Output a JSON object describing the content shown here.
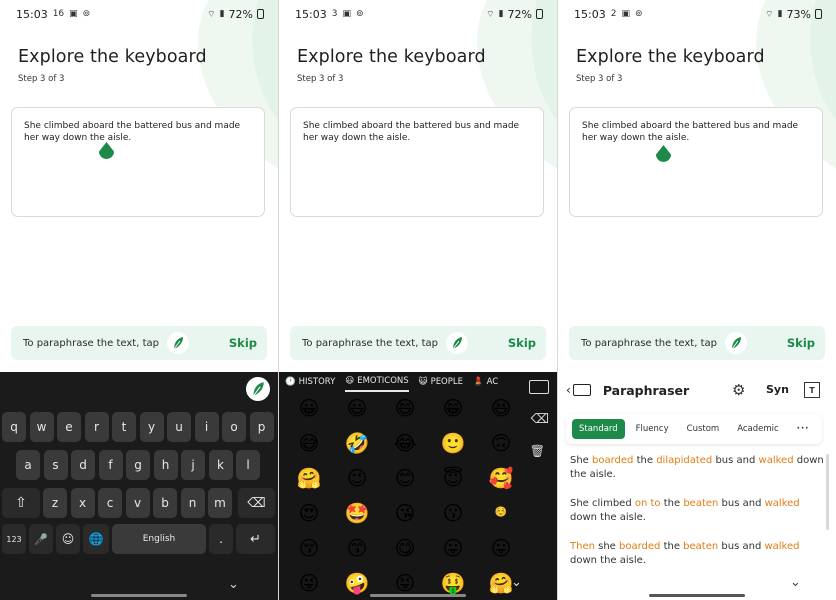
{
  "panels": [
    {
      "status": {
        "time": "15:03",
        "mini": "16",
        "battery": "72%"
      },
      "title": "Explore the keyboard",
      "step": "Step 3 of 3",
      "text": "She climbed aboard the battered bus and made her way down the aisle.",
      "hint": {
        "text": "To paraphrase the text, tap",
        "skip": "Skip"
      }
    },
    {
      "status": {
        "time": "15:03",
        "mini": "3",
        "battery": "72%"
      },
      "title": "Explore the keyboard",
      "step": "Step 3 of 3",
      "text": "She climbed aboard the battered bus and made her way down the aisle.",
      "hint": {
        "text": "To paraphrase the text, tap",
        "skip": "Skip"
      }
    },
    {
      "status": {
        "time": "15:03",
        "mini": "2",
        "battery": "73%"
      },
      "title": "Explore the keyboard",
      "step": "Step 3 of 3",
      "text": "She climbed aboard the battered bus and made her way down the aisle.",
      "hint": {
        "text": "To paraphrase the text, tap",
        "skip": "Skip"
      }
    }
  ],
  "keyboard": {
    "row1": [
      "q",
      "w",
      "e",
      "r",
      "t",
      "y",
      "u",
      "i",
      "o",
      "p"
    ],
    "row2": [
      "a",
      "s",
      "d",
      "f",
      "g",
      "h",
      "j",
      "k",
      "l"
    ],
    "row3": [
      "z",
      "x",
      "c",
      "v",
      "b",
      "n",
      "m"
    ],
    "shift": "⇧",
    "backspace": "⌫",
    "num": "123",
    "mic": "🎤",
    "emoji": "☺",
    "globe": "🌐",
    "space": "English",
    "period": ".",
    "enter": "↵"
  },
  "emoji_panel": {
    "tabs": [
      "HISTORY",
      "EMOTICONS",
      "PEOPLE",
      "AC"
    ],
    "tab_icons": [
      "🕐",
      "😃",
      "😺",
      "💄"
    ],
    "emojis": [
      "😀",
      "😃",
      "😄",
      "😁",
      "😆",
      "😅",
      "🤣",
      "😂",
      "🙂",
      "🙃",
      "🤗",
      "😉",
      "😊",
      "😇",
      "🥰",
      "😍",
      "🤩",
      "😘",
      "😗",
      "☺️",
      "😚",
      "😙",
      "😋",
      "😛",
      "😛",
      "😜",
      "🤪",
      "😝",
      "🤑",
      "🤗"
    ]
  },
  "paraphraser": {
    "title": "Paraphraser",
    "syn": "Syn",
    "frame": "T",
    "modes": [
      "Standard",
      "Fluency",
      "Custom",
      "Academic"
    ],
    "more": "···",
    "suggestions": [
      [
        {
          "t": "She "
        },
        {
          "t": "boarded",
          "c": 1
        },
        {
          "t": " the "
        },
        {
          "t": "dilapidated",
          "c": 1
        },
        {
          "t": " bus and "
        },
        {
          "t": "walked",
          "c": 1
        },
        {
          "t": " down the aisle."
        }
      ],
      [
        {
          "t": "She climbed "
        },
        {
          "t": "on to",
          "c": 1
        },
        {
          "t": " the "
        },
        {
          "t": "beaten",
          "c": 1
        },
        {
          "t": " bus and "
        },
        {
          "t": "walked",
          "c": 1
        },
        {
          "t": " down the aisle."
        }
      ],
      [
        {
          "t": "Then",
          "c": 1
        },
        {
          "t": " she "
        },
        {
          "t": "boarded",
          "c": 1
        },
        {
          "t": " the "
        },
        {
          "t": "beaten",
          "c": 1
        },
        {
          "t": " bus and "
        },
        {
          "t": "walked",
          "c": 1
        },
        {
          "t": " down the aisle."
        }
      ]
    ]
  },
  "colors": {
    "accent": "#1e8a4a",
    "highlight": "#e07d14",
    "hint_bg": "#e8f6ef"
  }
}
